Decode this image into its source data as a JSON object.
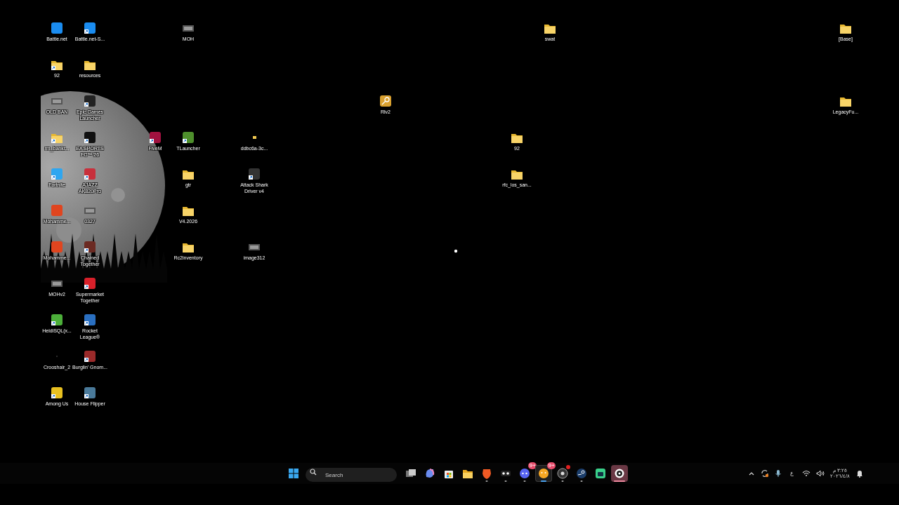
{
  "desktop_icons": [
    {
      "label": "Battle.net",
      "kind": "app",
      "color": "#1a8cf0",
      "shortcut": false
    },
    {
      "label": "Battle.net-S...",
      "kind": "app",
      "color": "#1a8cf0",
      "shortcut": true
    },
    {
      "label": "MOH",
      "kind": "thumbnail",
      "shortcut": false
    },
    {
      "label": "swat",
      "kind": "folder",
      "shortcut": false
    },
    {
      "label": "[Base]",
      "kind": "folder",
      "shortcut": false
    },
    {
      "label": "92",
      "kind": "folder",
      "shortcut": true
    },
    {
      "label": "resources",
      "kind": "folder",
      "shortcut": false
    },
    {
      "label": "OLD BAN",
      "kind": "thumbnail",
      "shortcut": false
    },
    {
      "label": "Epic Games Launcher",
      "kind": "app",
      "color": "#222222",
      "shortcut": true
    },
    {
      "label": "Rlv2",
      "kind": "key",
      "shortcut": false
    },
    {
      "label": "LegacyFu...",
      "kind": "folder",
      "shortcut": false
    },
    {
      "label": "rm_bankr...",
      "kind": "folder",
      "shortcut": true
    },
    {
      "label": "EA SPORTS FC™ 26",
      "kind": "app",
      "color": "#111111",
      "shortcut": true
    },
    {
      "label": "FiveM",
      "kind": "app",
      "color": "#a0123f",
      "shortcut": true
    },
    {
      "label": "TLauncher",
      "kind": "app",
      "color": "#4e8f2c",
      "shortcut": true
    },
    {
      "label": "ddbc6a-3c...",
      "kind": "small-folder",
      "shortcut": false
    },
    {
      "label": "92",
      "kind": "folder",
      "shortcut": false
    },
    {
      "label": "Fortnite",
      "kind": "app",
      "color": "#2ea6f0",
      "shortcut": true
    },
    {
      "label": "AJAZZ AK820Pro",
      "kind": "app",
      "color": "#c8303c",
      "shortcut": true
    },
    {
      "label": "gtr",
      "kind": "folder",
      "shortcut": false
    },
    {
      "label": "Attack Shark Driver v4",
      "kind": "app",
      "color": "#333333",
      "shortcut": true
    },
    {
      "label": "rfc_los_san...",
      "kind": "folder",
      "shortcut": false
    },
    {
      "label": "Mohamme...",
      "kind": "app",
      "color": "#e0451f",
      "shortcut": false
    },
    {
      "label": "0327",
      "kind": "thumbnail",
      "shortcut": false
    },
    {
      "label": "V4.2026",
      "kind": "folder",
      "shortcut": false
    },
    {
      "label": "Mohamme...",
      "kind": "app",
      "color": "#e0451f",
      "shortcut": false
    },
    {
      "label": "Chained Together",
      "kind": "app",
      "color": "#6b2a22",
      "shortcut": true
    },
    {
      "label": "Rc2inventory",
      "kind": "folder",
      "shortcut": false
    },
    {
      "label": "image312",
      "kind": "thumbnail",
      "shortcut": false
    },
    {
      "label": "MOHv2",
      "kind": "thumbnail",
      "shortcut": false
    },
    {
      "label": "Supermarket Together",
      "kind": "app",
      "color": "#d8202a",
      "shortcut": true
    },
    {
      "label": "HeidiSQL(x...",
      "kind": "app",
      "color": "#4caf3a",
      "shortcut": true
    },
    {
      "label": "Rocket League®",
      "kind": "app",
      "color": "#2a6fc0",
      "shortcut": true
    },
    {
      "label": "Crooshair_2",
      "kind": "blank",
      "shortcut": false
    },
    {
      "label": "Burglin' Gnom...",
      "kind": "app",
      "color": "#9a2a2a",
      "shortcut": true
    },
    {
      "label": "Among Us",
      "kind": "app",
      "color": "#e8c020",
      "shortcut": true
    },
    {
      "label": "House Flipper",
      "kind": "app",
      "color": "#4a7a9a",
      "shortcut": true
    }
  ],
  "taskbar": {
    "search": {
      "placeholder": "Search"
    },
    "apps": [
      {
        "kind": "start",
        "running": false,
        "selected": false,
        "flashing": false
      },
      {
        "kind": "task-view",
        "running": false,
        "selected": false,
        "flashing": false
      },
      {
        "kind": "copilot",
        "running": false,
        "selected": false,
        "flashing": false
      },
      {
        "kind": "store",
        "running": false,
        "selected": false,
        "flashing": false
      },
      {
        "kind": "explorer",
        "running": false,
        "selected": false,
        "flashing": false
      },
      {
        "kind": "lion",
        "running": true,
        "selected": false,
        "flashing": false
      },
      {
        "kind": "mask",
        "running": true,
        "selected": false,
        "flashing": false
      },
      {
        "kind": "chat",
        "running": true,
        "selected": false,
        "flashing": false,
        "badge": "9+"
      },
      {
        "kind": "face",
        "running": true,
        "selected": true,
        "flashing": false,
        "badge": "9+"
      },
      {
        "kind": "camera",
        "running": true,
        "selected": false,
        "flashing": false,
        "alert": true
      },
      {
        "kind": "steam",
        "running": true,
        "selected": false,
        "flashing": false
      },
      {
        "kind": "robot",
        "running": false,
        "selected": false,
        "flashing": false
      },
      {
        "kind": "record",
        "running": false,
        "selected": false,
        "flashing": true
      }
    ],
    "tray": {
      "language": "ع",
      "time": "٣:٢٥ م",
      "date": "٢٠٢٦/٤/٨"
    }
  }
}
